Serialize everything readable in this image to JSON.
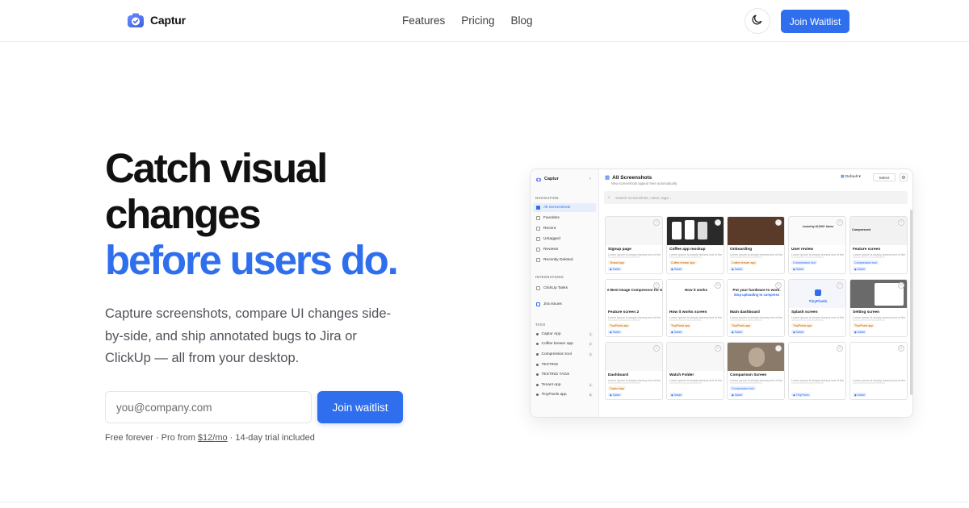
{
  "nav": {
    "brand": "Captur",
    "links": [
      "Features",
      "Pricing",
      "Blog"
    ],
    "cta": "Join Waitlist"
  },
  "hero": {
    "title_line1": "Catch visual",
    "title_line2": "changes",
    "title_line3": "before users do.",
    "subtitle": "Capture screenshots, compare UI changes side-by-side, and ship annotated bugs to Jira or ClickUp — all from your desktop.",
    "email_placeholder": "you@company.com",
    "join_label": "Join waitlist",
    "fine_print_a": "Free forever · Pro from ",
    "fine_print_price": "$12/mo",
    "fine_print_b": " · 14-day trial included"
  },
  "colors": {
    "accent": "#2f6fed",
    "text": "#111111",
    "muted": "#52525b"
  },
  "mock": {
    "app_name": "Captur",
    "navigation_label": "NAVIGATION",
    "nav_items": [
      "All Screenshots",
      "Favorites",
      "Recent",
      "Untagged",
      "Reviews",
      "Recently Deleted"
    ],
    "integrations_label": "INTEGRATIONS",
    "integrations": [
      "ClickUp Tasks",
      "Jira Issues"
    ],
    "tags_label": "TAGS",
    "tags": [
      {
        "name": "Captur App",
        "count": "1"
      },
      {
        "name": "Coffee brewer app",
        "count": "2"
      },
      {
        "name": "Compression tool",
        "count": "3"
      },
      {
        "name": "TESTING",
        "count": ""
      },
      {
        "name": "TESTING TAGS",
        "count": ""
      },
      {
        "name": "Tenant App",
        "count": "1"
      },
      {
        "name": "TinyPixels app",
        "count": "8"
      }
    ],
    "main_title": "All Screenshots",
    "main_subtitle": "New screenshots appear here automatically",
    "default_label": "Default",
    "select_label": "Select",
    "search_placeholder": "Search screenshots, notes, tags...",
    "cards": [
      {
        "title": "Signup page",
        "tag": "Tenant App",
        "chip": "Safari"
      },
      {
        "title": "Coffee app mockup",
        "tag": "Coffee brewer app",
        "chip": "Safari"
      },
      {
        "title": "Onboarding",
        "tag": "Coffee brewer app",
        "chip": "Safari"
      },
      {
        "title": "User review",
        "tag": "Compression tool",
        "chip": "Safari"
      },
      {
        "title": "Feature screen",
        "tag": "Compression tool",
        "chip": "Safari"
      },
      {
        "title": "Feature screen 2",
        "tag": "TinyPixels app",
        "chip": "Safari"
      },
      {
        "title": "How it works screen",
        "tag": "TinyPixels app",
        "chip": "Safari"
      },
      {
        "title": "Main dashboard",
        "tag": "TinyPixels app",
        "chip": "Safari"
      },
      {
        "title": "Splash screen",
        "tag": "TinyPixels app",
        "chip": "Safari"
      },
      {
        "title": "Setting screen",
        "tag": "TinyPixels app",
        "chip": "Safari"
      },
      {
        "title": "Dashboard",
        "tag": "Captur App",
        "chip": "Safari"
      },
      {
        "title": "Watch Folder",
        "tag": "",
        "chip": "Safari"
      },
      {
        "title": "Comparison Screen",
        "tag": "Compression tool",
        "chip": "Safari"
      },
      {
        "title": "",
        "tag": "",
        "chip": "TinyPixels"
      },
      {
        "title": "",
        "tag": "",
        "chip": "Safari"
      }
    ],
    "card_desc": "Lorem ipsum is simply dummy text of the",
    "thumb_text_1": "e Best Image Compressor for M",
    "thumb_text_2": "How it works",
    "thumb_text_3": "Put your hardware to work.",
    "thumb_text_3b": "Stop uploading to compress",
    "thumb_text_4": "TinyPixels",
    "thumb_text_5": "Loved by 10,000+ Users",
    "thumb_text_6": "Compressed"
  }
}
